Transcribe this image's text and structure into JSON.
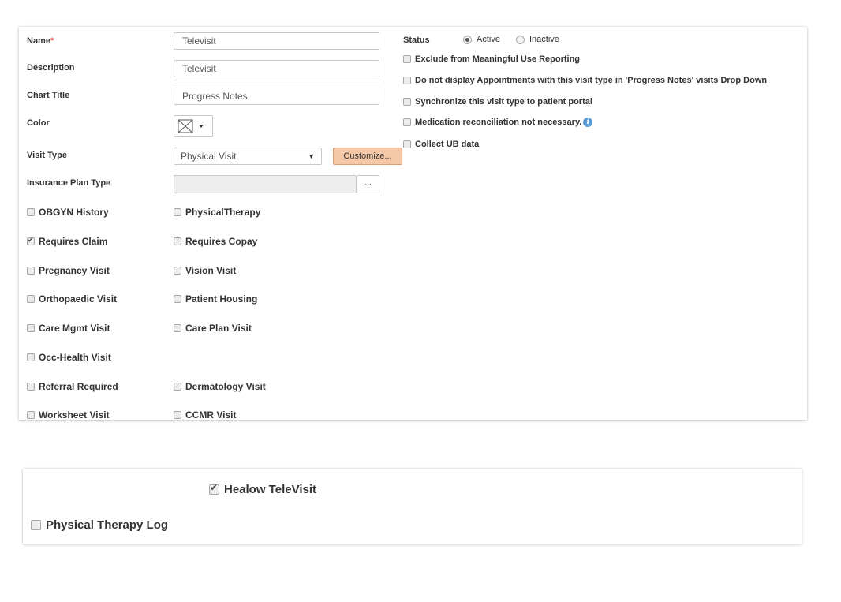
{
  "form": {
    "name_label": "Name",
    "required_mark": "*",
    "name_value": "Televisit",
    "description_label": "Description",
    "description_value": "Televisit",
    "chart_title_label": "Chart Title",
    "chart_title_value": "Progress Notes",
    "color_label": "Color",
    "color_icon": "no-color-swatch-icon",
    "visit_type_label": "Visit Type",
    "visit_type_value": "Physical Visit",
    "customize_label": "Customize...",
    "insurance_plan_type_label": "Insurance Plan Type",
    "insurance_plan_type_value": "",
    "insurance_browse_label": "..."
  },
  "status": {
    "label": "Status",
    "options": [
      {
        "label": "Active",
        "selected": true
      },
      {
        "label": "Inactive",
        "selected": false
      }
    ]
  },
  "right_checkboxes": [
    {
      "label": "Exclude from Meaningful Use Reporting",
      "checked": false
    },
    {
      "label": "Do not display Appointments with this visit type in 'Progress Notes' visits Drop Down",
      "checked": false
    },
    {
      "label": "Synchronize this visit type to patient portal",
      "checked": false
    },
    {
      "label": "Medication reconciliation not necessary.",
      "checked": false
    },
    {
      "label": "Collect UB data",
      "checked": false
    }
  ],
  "visit_flags_left": [
    {
      "label": "OBGYN History",
      "checked": false
    },
    {
      "label": "Requires Claim",
      "checked": true
    },
    {
      "label": "Pregnancy Visit",
      "checked": false
    },
    {
      "label": "Orthopaedic Visit",
      "checked": false
    },
    {
      "label": "Care Mgmt Visit",
      "checked": false
    },
    {
      "label": "Occ-Health Visit",
      "checked": false
    },
    {
      "label": "Referral Required",
      "checked": false
    },
    {
      "label": "Worksheet Visit",
      "checked": false
    }
  ],
  "visit_flags_right": [
    {
      "label": "PhysicalTherapy",
      "checked": false
    },
    {
      "label": "Requires Copay",
      "checked": false
    },
    {
      "label": "Vision Visit",
      "checked": false
    },
    {
      "label": "Patient Housing",
      "checked": false
    },
    {
      "label": "Care Plan Visit",
      "checked": false
    },
    {
      "label": "Dermatology Visit",
      "checked": false
    },
    {
      "label": "CCMR Visit",
      "checked": false
    }
  ],
  "bottom": {
    "healow_label": "Healow TeleVisit",
    "healow_checked": true,
    "pt_log_label": "Physical Therapy Log",
    "pt_log_checked": false
  },
  "colors": {
    "customize_bg": "#f5c8a8",
    "required": "#d9534f",
    "info": "#5b9bd5"
  }
}
